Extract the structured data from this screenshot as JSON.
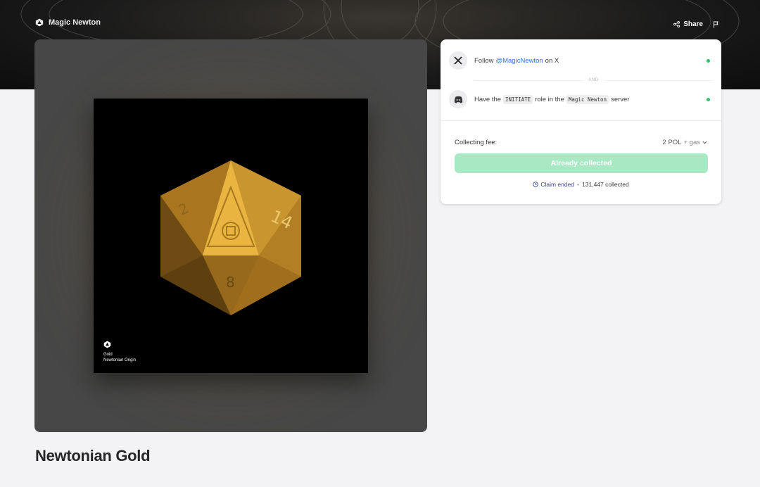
{
  "header": {
    "brand_name": "Magic Newton",
    "share_label": "Share"
  },
  "artwork": {
    "caption_line1": "Gold",
    "caption_line2": "Newtonian Origin",
    "die_number_right": "14",
    "die_number_left": "2",
    "die_number_bottom": "8"
  },
  "nft": {
    "title": "Newtonian Gold"
  },
  "requirements": {
    "x_follow": {
      "prefix": "Follow",
      "handle": "@MagicNewton",
      "suffix": "on X"
    },
    "and_label": "AND",
    "discord_role": {
      "prefix": "Have the",
      "role": "INITIATE",
      "middle": "role in the",
      "server": "Magic Newton",
      "suffix": "server"
    }
  },
  "collect": {
    "fee_label": "Collecting fee:",
    "fee_amount": "2 POL",
    "fee_gas": "+ gas",
    "button_label": "Already collected",
    "claim_status": "Claim ended",
    "separator": "•",
    "collected_count": "131,447 collected"
  },
  "colors": {
    "accent_link": "#2f6fe0",
    "status_dot": "#2ec26a",
    "button_disabled": "#a8e8c2",
    "gold": "#d4a233"
  },
  "icons": [
    "magic-newton-logo-icon",
    "share-icon",
    "flag-icon",
    "x-logo-icon",
    "discord-icon",
    "clock-icon",
    "chevron-down-icon"
  ]
}
